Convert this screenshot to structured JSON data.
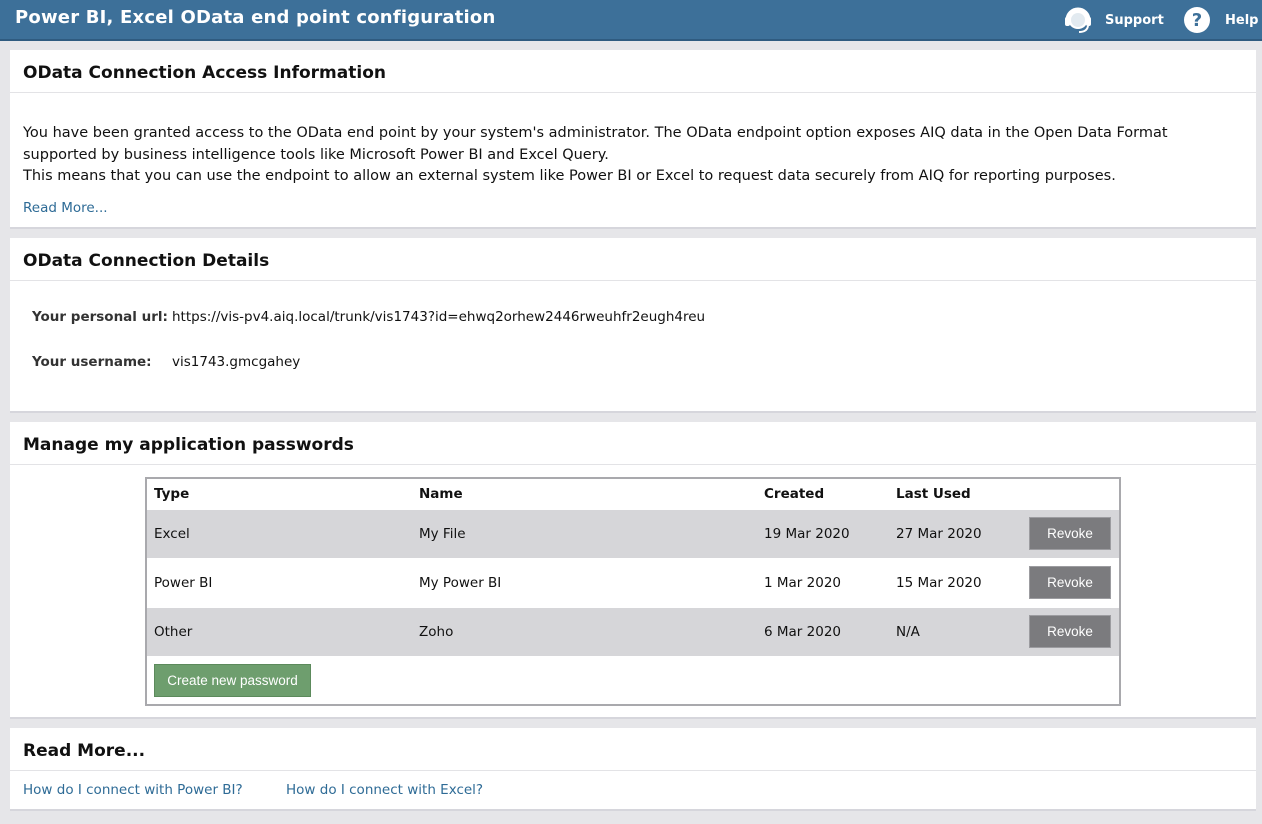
{
  "header": {
    "title": "Power BI, Excel OData end point configuration",
    "support_label": "Support",
    "help_label": "Help"
  },
  "access_info": {
    "heading": "OData Connection Access Information",
    "paragraph_1": "You have been granted access to the OData end point by your system's administrator. The OData endpoint option exposes AIQ data in the Open Data Format supported by business intelligence tools like Microsoft Power BI and Excel Query.",
    "paragraph_2": "This means that you can use the endpoint to allow an external system like Power BI or Excel to request data securely from AIQ for reporting purposes.",
    "read_more": "Read More..."
  },
  "connection_details": {
    "heading": "OData Connection Details",
    "url_label": "Your personal url:",
    "url_value": "https://vis-pv4.aiq.local/trunk/vis1743?id=ehwq2orhew2446rweuhfr2eugh4reu",
    "username_label": "Your username:",
    "username_value": "vis1743.gmcgahey"
  },
  "passwords": {
    "heading": "Manage my application passwords",
    "columns": [
      "Type",
      "Name",
      "Created",
      "Last Used"
    ],
    "rows": [
      {
        "type": "Excel",
        "name": "My File",
        "created": "19 Mar 2020",
        "last_used": "27 Mar 2020",
        "action": "Revoke"
      },
      {
        "type": "Power BI",
        "name": "My Power BI",
        "created": "1 Mar 2020",
        "last_used": "15 Mar 2020",
        "action": "Revoke"
      },
      {
        "type": "Other",
        "name": "Zoho",
        "created": "6 Mar 2020",
        "last_used": "N/A",
        "action": "Revoke"
      }
    ],
    "create_label": "Create new password"
  },
  "read_more_section": {
    "heading": "Read More...",
    "links": [
      "How do I connect with Power BI?",
      "How do I connect with Excel?"
    ]
  },
  "colors": {
    "header_bg": "#3d7099",
    "link": "#2e6b96",
    "revoke_button": "#7b7b7e",
    "create_button": "#6e9e6e",
    "row_alt": "#d6d6d9"
  }
}
